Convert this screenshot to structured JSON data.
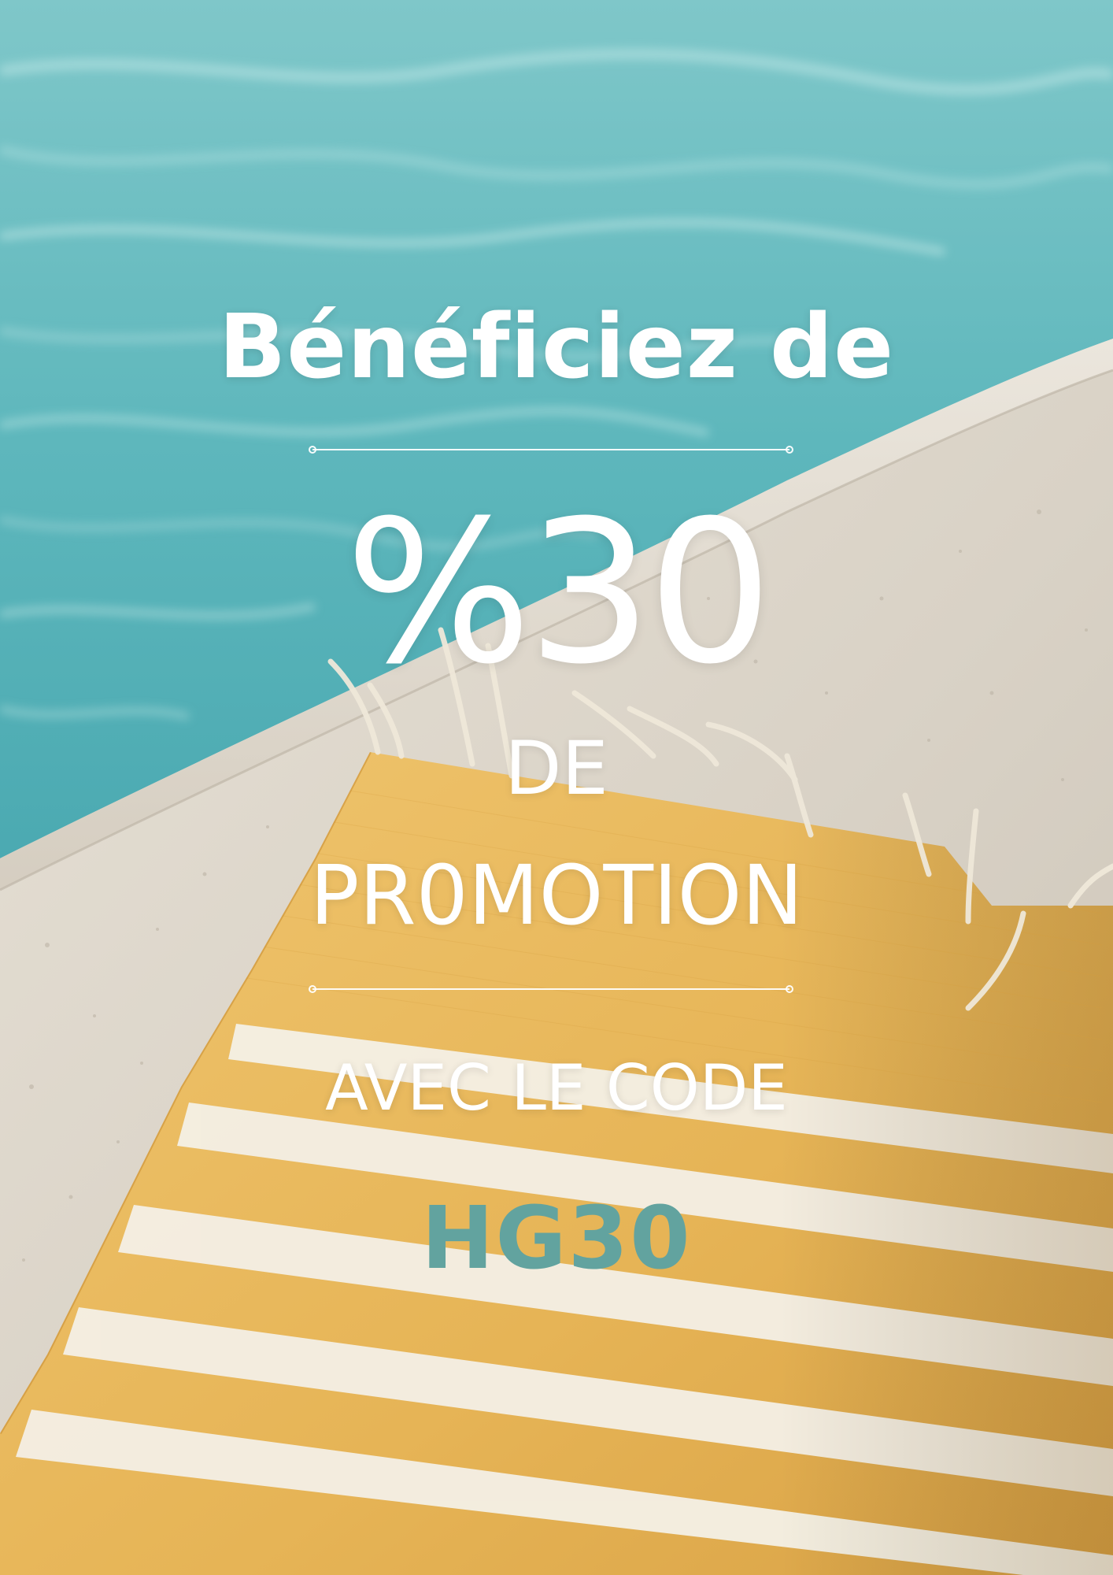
{
  "headline": "Bénéficiez de",
  "discount": "%30",
  "label_line1": "DE",
  "label_line2": "PR0MOTION",
  "code_intro": "AVEC LE CODE",
  "promo_code": "HG30",
  "colors": {
    "text": "#ffffff",
    "code_accent": "#62a39f",
    "water": "#5fb8bd",
    "stone": "#ddd6cb",
    "towel_yellow": "#e9b95a",
    "towel_stripe": "#f4efe4"
  }
}
